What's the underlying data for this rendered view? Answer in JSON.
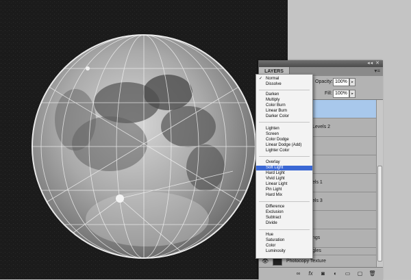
{
  "panel": {
    "tab_label": "LAYERS",
    "opacity_label": "Opacity:",
    "opacity_value": "100%",
    "fill_label": "Fill:",
    "fill_value": "100%"
  },
  "layers": [
    {
      "name": "",
      "selected": true
    },
    {
      "name": "Levels 2"
    },
    {
      "name": ""
    },
    {
      "name": ""
    },
    {
      "name": "els 1"
    },
    {
      "name": "els 3"
    },
    {
      "name": ""
    },
    {
      "name": "ngs"
    },
    {
      "name": "gles"
    }
  ],
  "texture_layer": {
    "name": "Photocopy Texture",
    "visible": true
  },
  "blend_modes": {
    "current": "Normal",
    "groups": [
      [
        "Normal",
        "Dissolve"
      ],
      [
        "Darken",
        "Multiply",
        "Color Burn",
        "Linear Burn",
        "Darker Color"
      ],
      [
        "Lighten",
        "Screen",
        "Color Dodge",
        "Linear Dodge (Add)",
        "Lighter Color"
      ],
      [
        "Overlay",
        "Soft Light",
        "Hard Light",
        "Vivid Light",
        "Linear Light",
        "Pin Light",
        "Hard Mix"
      ],
      [
        "Difference",
        "Exclusion",
        "Subtract",
        "Divide"
      ],
      [
        "Hue",
        "Saturation",
        "Color",
        "Luminosity"
      ]
    ],
    "highlighted": "Soft Light"
  },
  "footer_icons": [
    "link-icon",
    "fx-icon",
    "mask-icon",
    "adjustment-icon",
    "group-icon",
    "new-layer-icon",
    "trash-icon"
  ],
  "colors": {
    "selection": "#3a67d4",
    "selected_layer": "#a8c8ec"
  }
}
